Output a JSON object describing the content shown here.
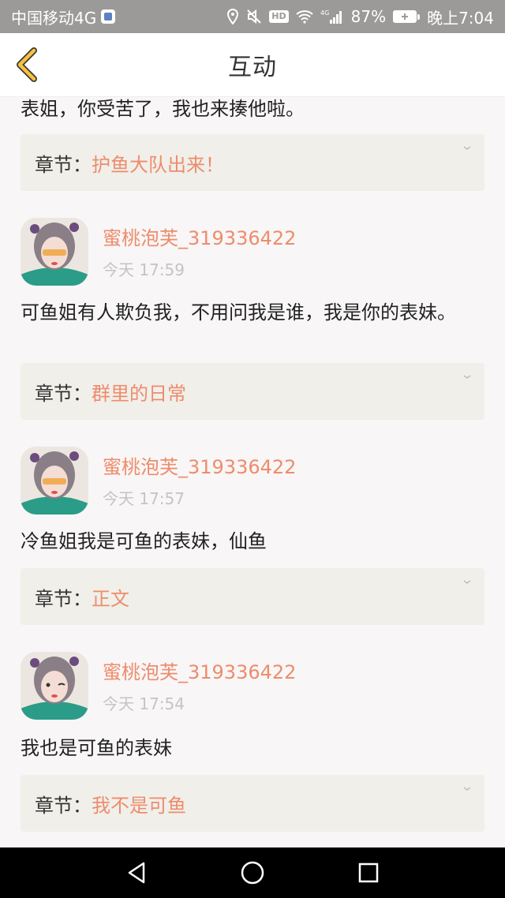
{
  "status_bar": {
    "carrier": "中国移动4G",
    "network": "4G",
    "battery": "87%",
    "time": "晚上7:04",
    "icons": [
      "location-icon",
      "mute-icon",
      "hd-icon",
      "wifi-icon",
      "signal-icon",
      "battery-icon"
    ]
  },
  "header": {
    "title": "互动",
    "back_icon": "chevron-left-icon"
  },
  "colors": {
    "accent": "#ee8c6c",
    "back_arrow": "#f6c23e",
    "chapter_bg": "#f0efea",
    "status_bar_bg": "#9c9a99"
  },
  "first_item": {
    "comment": "表姐，你受苦了，我也来揍他啦。",
    "chapter_label": "章节：",
    "chapter_name": "护鱼大队出来！"
  },
  "items": [
    {
      "username": "蜜桃泡芙_319336422",
      "time": "今天 17:59",
      "comment": "可鱼姐有人欺负我，不用问我是谁，我是你的表妹。",
      "chapter_label": "章节：",
      "chapter_name": "群里的日常"
    },
    {
      "username": "蜜桃泡芙_319336422",
      "time": "今天 17:57",
      "comment": "冷鱼姐我是可鱼的表妹，仙鱼",
      "chapter_label": "章节：",
      "chapter_name": "正文"
    },
    {
      "username": "蜜桃泡芙_319336422",
      "time": "今天 17:54",
      "comment": "我也是可鱼的表妹",
      "chapter_label": "章节：",
      "chapter_name": "我不是可鱼"
    }
  ],
  "nav_bar": {
    "buttons": [
      "back-triangle-icon",
      "home-circle-icon",
      "recents-square-icon"
    ]
  }
}
